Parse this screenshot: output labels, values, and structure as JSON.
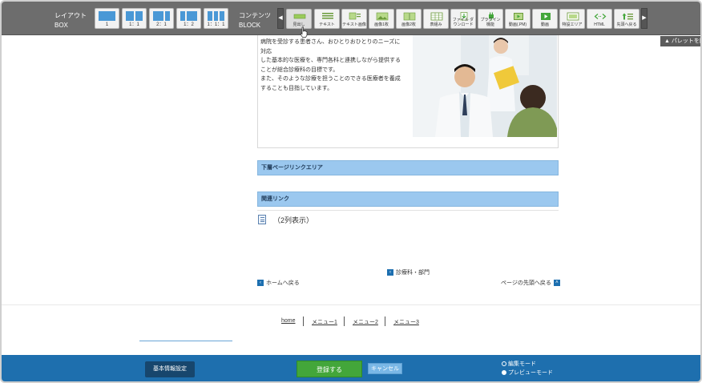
{
  "toolbar": {
    "layout_label": "レイアウト",
    "box_label": "BOX",
    "contents_label": "コンテンツ",
    "block_label": "BLOCK",
    "layouts": [
      {
        "label": "1",
        "ratio": [
          1
        ]
      },
      {
        "label": "1：1",
        "ratio": [
          1,
          1
        ]
      },
      {
        "label": "2：1",
        "ratio": [
          2,
          1
        ]
      },
      {
        "label": "1：2",
        "ratio": [
          1,
          2
        ]
      },
      {
        "label": "1：1：1",
        "ratio": [
          1,
          1,
          1
        ]
      }
    ],
    "blocks": [
      {
        "label": "見出し",
        "icon": "heading-icon"
      },
      {
        "label": "テキスト",
        "icon": "text-icon"
      },
      {
        "label": "テキスト画像",
        "icon": "text-image-icon"
      },
      {
        "label": "画像1枚",
        "icon": "image-one-icon"
      },
      {
        "label": "画像2枚",
        "icon": "image-two-icon"
      },
      {
        "label": "表組み",
        "icon": "table-icon"
      },
      {
        "label": "ファイル ダウンロード",
        "icon": "file-download-icon"
      },
      {
        "label": "プラグイン 機能",
        "icon": "plugin-icon"
      },
      {
        "label": "動画(.PM)",
        "icon": "video-file-icon"
      },
      {
        "label": "動画",
        "icon": "video-icon"
      },
      {
        "label": "特設エリア",
        "icon": "special-area-icon"
      },
      {
        "label": "HTML",
        "icon": "html-icon"
      },
      {
        "label": "先頭へ戻る",
        "icon": "back-to-top-icon"
      }
    ],
    "palette_toggle": "▲ パレットを閉"
  },
  "content": {
    "body_lines": [
      "病院を受診する患者さん、おひとりおひとりのニーズに対応",
      "した基本的な医療を、専門各科と連携しながら提供することが総合診療科の目標です。",
      "また、そのような診療を担うことのできる医療者を養成することも目指しています。"
    ],
    "section_lower_links": "下層ページリンクエリア",
    "section_related": "関連リンク",
    "two_col": "（2列表示）"
  },
  "nav": {
    "dept": "診療科・部門",
    "home": "ホームへ戻る",
    "top": "ページの先頭へ戻る"
  },
  "footer_menu": [
    "home",
    "メニュー1",
    "メニュー2",
    "メニュー3"
  ],
  "bottom": {
    "basic_settings": "基本情報設定",
    "save": "登録する",
    "cancel": "キャンセル",
    "edit_mode": "編集モード",
    "preview_mode": "プレビューモード"
  },
  "colors": {
    "toolbar_bg": "#6d6d6d",
    "accent_blue": "#1e6fae",
    "section_head": "#9bc8ef",
    "save_green": "#43a63a"
  }
}
